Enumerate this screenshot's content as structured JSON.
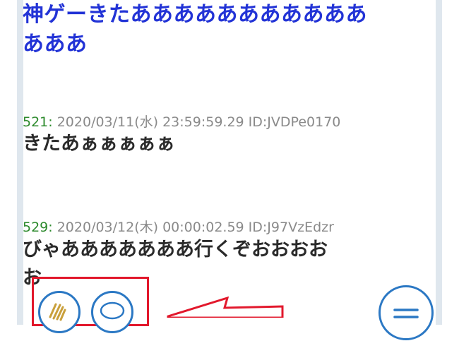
{
  "thread": {
    "headline_line1": "神ゲーきたあああああああああああ",
    "headline_line2": "あああ",
    "posts": [
      {
        "number": "521:",
        "meta": " 2020/03/11(水) 23:59:59.29 ID:JVDPe0170",
        "body_line1": "きたあぁぁぁぁぁ"
      },
      {
        "number": "529:",
        "meta": " 2020/03/12(木) 00:00:02.59 ID:J97VzEdzr",
        "body_line1": "びゃあああああああ行くぞおおおお",
        "body_line2": "お"
      }
    ]
  },
  "actions": {
    "clap_icon": "clap-icon",
    "comment_icon": "speech-bubble-icon",
    "menu_icon": "hamburger-menu-icon"
  },
  "colors": {
    "headline": "#2233d6",
    "post_number": "#2c8a2c",
    "meta": "#8a8a8a",
    "accent": "#2b78c4",
    "highlight": "#e2182c"
  }
}
